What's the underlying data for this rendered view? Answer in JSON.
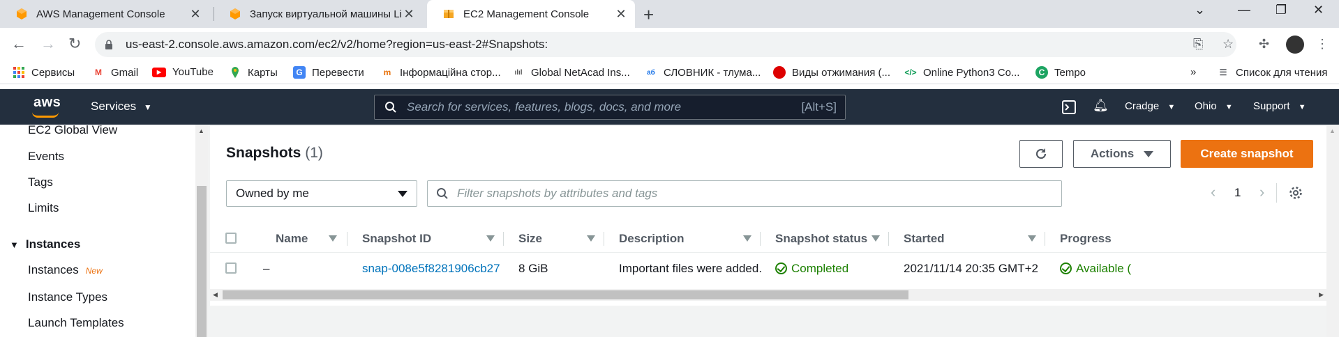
{
  "browser": {
    "tabs": [
      {
        "title": "AWS Management Console",
        "active": false
      },
      {
        "title": "Запуск виртуальной машины Li",
        "active": false
      },
      {
        "title": "EC2 Management Console",
        "active": true
      }
    ],
    "new_tab_label": "+",
    "url": "us-east-2.console.aws.amazon.com/ec2/v2/home?region=us-east-2#Snapshots:",
    "bookmarks": [
      {
        "label": "Сервисы",
        "icon": "apps-grid-icon"
      },
      {
        "label": "Gmail",
        "icon": "gmail-icon"
      },
      {
        "label": "YouTube",
        "icon": "youtube-icon"
      },
      {
        "label": "Карты",
        "icon": "maps-pin-icon"
      },
      {
        "label": "Перевести",
        "icon": "translate-icon"
      },
      {
        "label": "Інформаційна стор...",
        "icon": "page-icon"
      },
      {
        "label": "Global NetAcad Ins...",
        "icon": "cisco-icon"
      },
      {
        "label": "СЛОВНИК - тлума...",
        "icon": "dictionary-icon"
      },
      {
        "label": "Виды отжимания (...",
        "icon": "red-ball-icon"
      },
      {
        "label": "Online Python3 Co...",
        "icon": "code-icon"
      },
      {
        "label": "Tempo",
        "icon": "tempo-icon"
      }
    ],
    "more_bookmarks": "»",
    "reading_list": "Список для чтения"
  },
  "aws_header": {
    "logo": "aws",
    "services": "Services",
    "search_placeholder": "Search for services, features, blogs, docs, and more",
    "search_shortcut": "[Alt+S]",
    "account": "Cradge",
    "region": "Ohio",
    "support": "Support"
  },
  "sidebar": {
    "items_top": [
      "EC2 Global View",
      "Events",
      "Tags",
      "Limits"
    ],
    "section": "Instances",
    "section_items": [
      {
        "label": "Instances",
        "badge": "New"
      },
      {
        "label": "Instance Types",
        "badge": ""
      },
      {
        "label": "Launch Templates",
        "badge": ""
      }
    ]
  },
  "main": {
    "title": "Snapshots",
    "count": "(1)",
    "actions_label": "Actions",
    "create_label": "Create snapshot",
    "owner_filter": "Owned by me",
    "filter_placeholder": "Filter snapshots by attributes and tags",
    "page_number": "1",
    "columns": [
      "Name",
      "Snapshot ID",
      "Size",
      "Description",
      "Snapshot status",
      "Started",
      "Progress"
    ],
    "rows": [
      {
        "name": "–",
        "snapshot_id": "snap-008e5f8281906cb27",
        "size": "8 GiB",
        "description": "Important files were added.",
        "status": "Completed",
        "started": "2021/11/14 20:35 GMT+2",
        "progress": "Available ("
      }
    ]
  },
  "colors": {
    "aws_header_bg": "#232f3e",
    "primary_button": "#ec7211",
    "link": "#0073bb",
    "success": "#1d8102"
  }
}
